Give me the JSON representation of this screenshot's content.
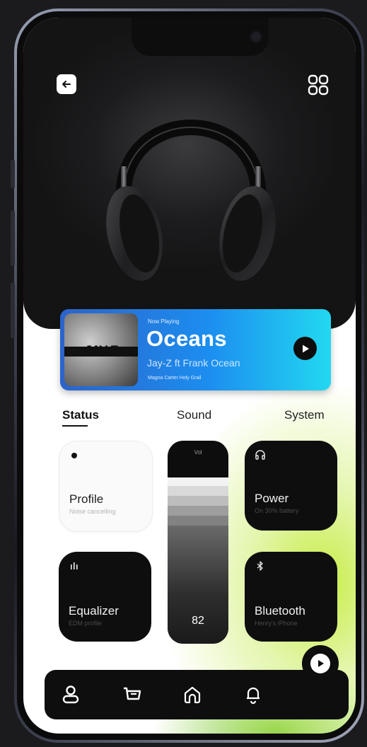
{
  "now_playing": {
    "label": "Now Playing",
    "song": "Oceans",
    "artist": "Jay-Z ft Frank Ocean",
    "album": "Magna Carter Holy Grail",
    "album_art_text": "JAY-Z"
  },
  "tabs": [
    {
      "label": "Status",
      "active": true
    },
    {
      "label": "Sound",
      "active": false
    },
    {
      "label": "System",
      "active": false
    }
  ],
  "tiles": {
    "profile": {
      "title": "Profile",
      "subtitle": "Noise cancelling",
      "icon": "radio-dot-icon"
    },
    "power": {
      "title": "Power",
      "subtitle": "On 30% battery",
      "icon": "headphones-icon"
    },
    "equalizer": {
      "title": "Equalizer",
      "subtitle": "EDM profile",
      "icon": "equalizer-icon"
    },
    "bluetooth": {
      "title": "Bluetooth",
      "subtitle": "Henry's iPhone",
      "icon": "bluetooth-icon"
    }
  },
  "volume": {
    "label": "Vol",
    "value": "82",
    "level": 0.82
  },
  "nav": [
    "user-icon",
    "cart-icon",
    "home-icon",
    "bell-icon"
  ],
  "colors": {
    "accent_start": "#2d63c9",
    "accent_end": "#22d8f0",
    "lime": "#c4ec3a",
    "dark": "#0e0e0f"
  }
}
